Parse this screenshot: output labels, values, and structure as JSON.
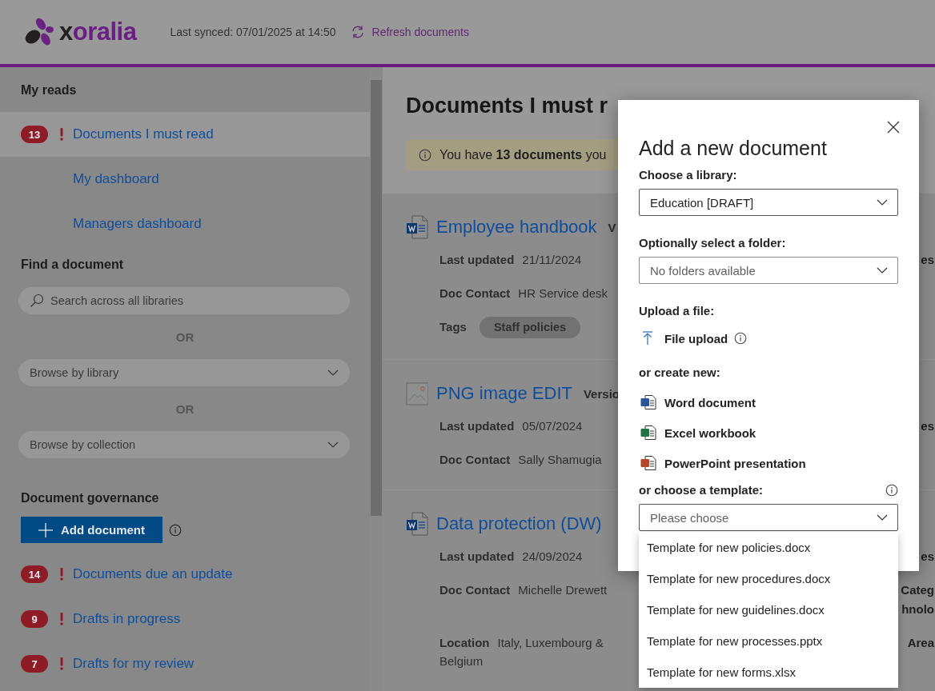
{
  "header": {
    "logo_text": "xoralia",
    "last_synced": "Last synced: 07/01/2025 at 14:50",
    "refresh_link": "Refresh documents"
  },
  "sidebar": {
    "my_reads": {
      "heading": "My reads",
      "items": [
        {
          "label": "Documents I must read",
          "count": "13",
          "flagged": true,
          "selected": true
        },
        {
          "label": "My dashboard",
          "selected": false
        },
        {
          "label": "Managers dashboard",
          "selected": false
        }
      ]
    },
    "find": {
      "heading": "Find a document",
      "search": {
        "placeholder": "Search across all libraries"
      },
      "controls": [
        {
          "kind": "separator",
          "text": "OR"
        },
        {
          "kind": "dropdown",
          "text": "Browse by library"
        },
        {
          "kind": "separator",
          "text": "OR"
        },
        {
          "kind": "dropdown",
          "text": "Browse by collection"
        }
      ]
    },
    "governance": {
      "heading": "Document governance",
      "add_button": "Add document",
      "items": [
        {
          "label": "Documents due an update",
          "count": "14",
          "flagged": true,
          "selected": false
        },
        {
          "label": "Drafts in progress",
          "count": "9",
          "flagged": true,
          "selected": false
        },
        {
          "label": "Drafts for my review",
          "count": "7",
          "flagged": true,
          "selected": false
        }
      ]
    }
  },
  "main": {
    "heading": "Documents I must r",
    "banner": "You have **13 documents** you",
    "cards": [
      {
        "kind": "word",
        "title": "Employee handbook",
        "version": "V",
        "fields": [
          {
            "label": "Last updated",
            "value": "21/11/2024",
            "side": [
              "es"
            ]
          },
          {
            "label": "Doc Contact",
            "value": "HR Service desk"
          }
        ],
        "tags_label": "Tags",
        "tags": [
          "Staff policies"
        ]
      },
      {
        "kind": "image",
        "title": "PNG image EDIT",
        "version": "Versio",
        "fields": [
          {
            "label": "Last updated",
            "value": "05/07/2024",
            "side": [
              "es"
            ]
          },
          {
            "label": "Doc Contact",
            "value": "Sally Shamugia"
          }
        ]
      },
      {
        "kind": "word",
        "title": "Data protection (DW)",
        "fields": [
          {
            "label": "Last updated",
            "value": "24/09/2024",
            "side": [
              "es"
            ]
          },
          {
            "label": "Doc Contact",
            "value": "Michelle Drewett",
            "side": [
              "Categ",
              "hnolo"
            ]
          },
          {
            "label": "Location",
            "value": "Italy, Luxembourg & Belgium",
            "side": [
              "Area"
            ]
          }
        ]
      }
    ]
  },
  "dialog": {
    "title": "Add a new document",
    "library": {
      "label": "Choose a library:",
      "value": "Education [DRAFT]",
      "disabled": false
    },
    "folder": {
      "label": "Optionally select a folder:",
      "value": "No folders available",
      "disabled": true
    },
    "upload": {
      "label": "Upload a file:",
      "action": "File upload"
    },
    "create": {
      "label": "or create new:",
      "items": [
        {
          "kind": "word",
          "label": "Word document"
        },
        {
          "kind": "excel",
          "label": "Excel workbook"
        },
        {
          "kind": "powerpoint",
          "label": "PowerPoint presentation"
        }
      ]
    },
    "template": {
      "label": "or choose a template:",
      "placeholder": "Please choose",
      "expanded": true,
      "options": [
        {
          "label": "Template for new policies.docx",
          "selected": false
        },
        {
          "label": "Template for new procedures.docx",
          "selected": false
        },
        {
          "label": "Template for new guidelines.docx",
          "selected": false
        },
        {
          "label": "Template for new processes.pptx",
          "selected": false
        },
        {
          "label": "Template for new forms.xlsx",
          "selected": false
        }
      ]
    }
  }
}
